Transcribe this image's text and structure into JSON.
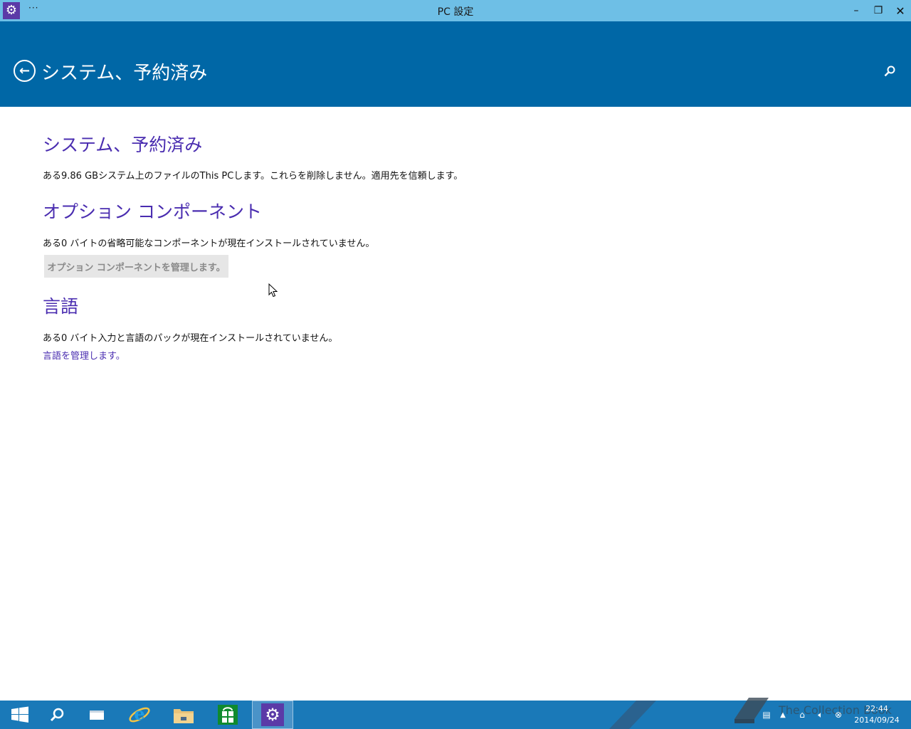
{
  "window": {
    "title": "PC 設定",
    "menu_label": "···",
    "app_icon": "gear-icon",
    "controls": {
      "minimize": "–",
      "maximize": "❐",
      "close": "✕"
    }
  },
  "header": {
    "title": "システム、予約済み",
    "back_icon": "back-arrow-icon",
    "search_icon": "search-icon"
  },
  "sections": {
    "system": {
      "heading": "システム、予約済み",
      "text": "ある9.86 GBシステム上のファイルのThis PCします。これらを削除しません。適用先を信頼します。"
    },
    "optional": {
      "heading": "オプション コンポーネント",
      "text": "ある0 バイトの省略可能なコンポーネントが現在インストールされていません。",
      "button_label": "オプション コンポーネントを管理します。"
    },
    "language": {
      "heading": "言語",
      "text": "ある0 バイト入力と言語のパックが現在インストールされていません。",
      "link_label": "言語を管理します。"
    }
  },
  "taskbar": {
    "items": [
      "start-icon",
      "search-icon",
      "task-view-icon",
      "internet-explorer-icon",
      "file-explorer-icon",
      "store-icon",
      "settings-icon"
    ],
    "time": "22:44",
    "date": "2014/09/24",
    "watermark": "The Collection Book"
  },
  "colors": {
    "titlebar": "#6ebfe6",
    "header": "#0067a6",
    "accent_text": "#4a2db0",
    "taskbar": "#1a79b8"
  }
}
